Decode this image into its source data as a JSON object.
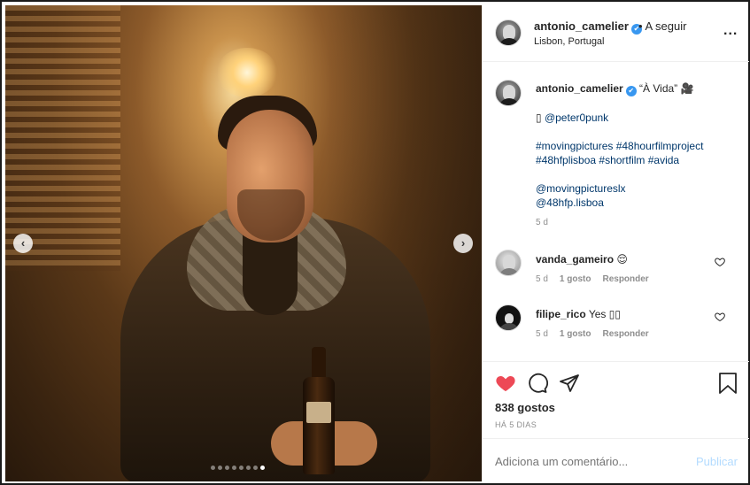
{
  "post": {
    "username": "antonio_camelier",
    "verified_mark": "✔",
    "follow_label": "• A seguir",
    "location": "Lisbon, Portugal",
    "more_label": "...",
    "carousel_count": 8,
    "carousel_active": 8
  },
  "caption": {
    "username": "antonio_camelier",
    "title": "“À Vida”",
    "title_emoji": "🎥",
    "credit_glyph": "▯",
    "credit_handle": "@peter0punk",
    "hashtags_line1": "#movingpictures #48hourfilmproject",
    "hashtags_line2": "#48hfplisboa #shortfilm #avida",
    "mention1": "@movingpictureslx",
    "mention2": "@48hfp.lisboa",
    "time": "5 d"
  },
  "comments": [
    {
      "username": "vanda_gameiro",
      "text": "😌",
      "time": "5 d",
      "likes": "1 gosto",
      "reply": "Responder"
    },
    {
      "username": "filipe_rico",
      "text": "Yes ▯▯",
      "time": "5 d",
      "likes": "1 gosto",
      "reply": "Responder"
    }
  ],
  "actions": {
    "likes_count": "838 gostos",
    "posted_ago": "HÁ 5 DIAS",
    "comment_placeholder": "Adiciona um comentário...",
    "post_label": "Publicar"
  },
  "colors": {
    "like_red": "#ed4956",
    "link_blue": "#00376b",
    "verified_blue": "#3897f0",
    "post_disabled": "#b3dbff"
  },
  "icons": {
    "prev": "chevron-left-icon",
    "next": "chevron-right-icon",
    "like": "heart-icon",
    "comment": "comment-icon",
    "share": "paper-plane-icon",
    "save": "bookmark-icon"
  }
}
